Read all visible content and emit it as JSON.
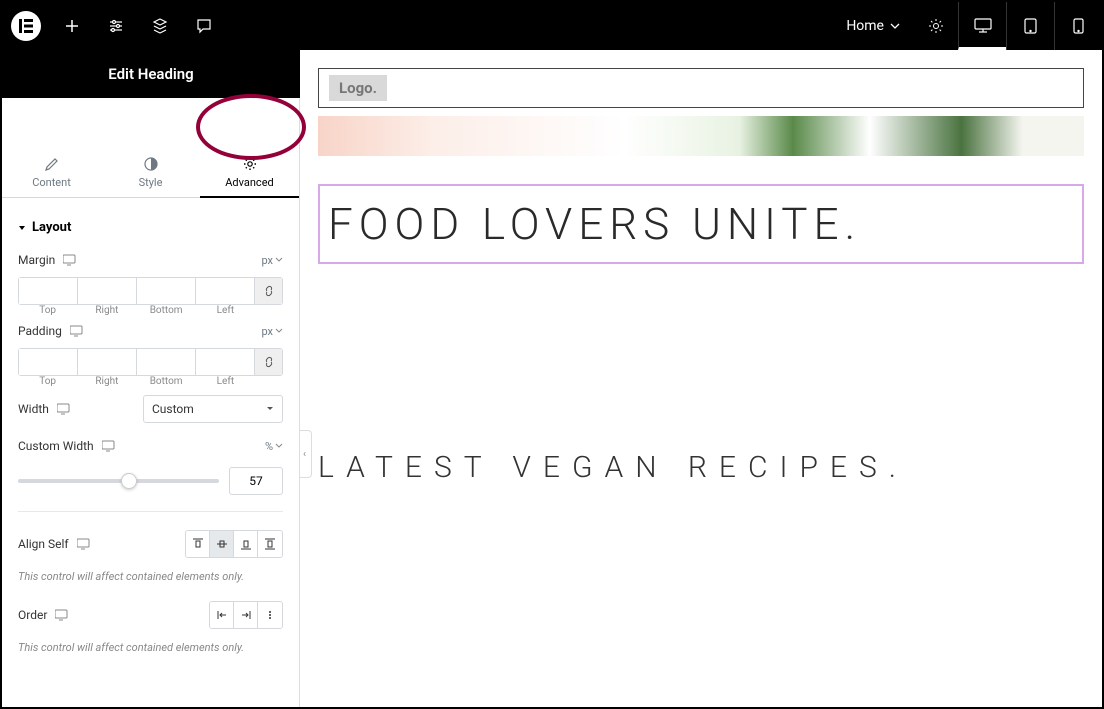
{
  "topbar": {
    "logo_letter": "E",
    "home_label": "Home"
  },
  "panel": {
    "title": "Edit Heading",
    "tabs": {
      "content": "Content",
      "style": "Style",
      "advanced": "Advanced"
    }
  },
  "layout": {
    "section_label": "Layout",
    "margin": {
      "label": "Margin",
      "unit": "px",
      "top": "",
      "right": "",
      "bottom": "",
      "left": "",
      "labels": {
        "top": "Top",
        "right": "Right",
        "bottom": "Bottom",
        "left": "Left"
      }
    },
    "padding": {
      "label": "Padding",
      "unit": "px",
      "top": "",
      "right": "",
      "bottom": "",
      "left": "",
      "labels": {
        "top": "Top",
        "right": "Right",
        "bottom": "Bottom",
        "left": "Left"
      }
    },
    "width": {
      "label": "Width",
      "value": "Custom"
    },
    "custom_width": {
      "label": "Custom Width",
      "unit": "%",
      "value": "57",
      "percent": 57
    },
    "align_self": {
      "label": "Align Self",
      "note": "This control will affect contained elements only."
    },
    "order": {
      "label": "Order",
      "note": "This control will affect contained elements only."
    }
  },
  "canvas": {
    "logo_text": "Logo.",
    "heading1": "FOOD LOVERS UNITE.",
    "heading2": "LATEST VEGAN RECIPES."
  }
}
